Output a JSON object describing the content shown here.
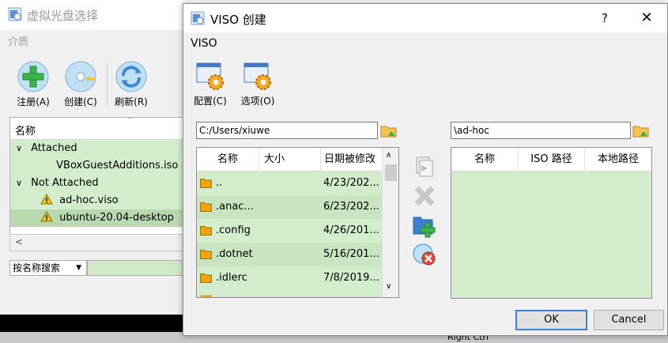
{
  "background_window": {
    "title": "虚拟光盘选择",
    "medium_label": "介质",
    "toolbar": [
      {
        "label": "注册(A)",
        "icon": "add-icon"
      },
      {
        "label": "创建(C)",
        "icon": "disc-create-icon"
      },
      {
        "label": "刷新(R)",
        "icon": "refresh-icon"
      }
    ],
    "list_header": "名称",
    "groups": [
      {
        "label": "Attached",
        "items": [
          "VBoxGuestAdditions.iso"
        ]
      },
      {
        "label": "Not Attached",
        "items": [
          "ad-hoc.viso",
          "ubuntu-20.04-desktop"
        ]
      }
    ],
    "search_mode": "按名称搜索",
    "taskbar_right_ctrl": "Right Ctrl"
  },
  "dialog": {
    "title": "VISO 创建",
    "help": "?",
    "close": "✕",
    "heading": "VISO",
    "toolbar": [
      {
        "label": "配置(C)",
        "icon": "config-gear-icon"
      },
      {
        "label": "选项(O)",
        "icon": "options-gear-icon"
      }
    ],
    "host_path": "C:/Users/xiuwe",
    "viso_path": "\\ad-hoc",
    "host_columns": [
      "名称",
      "大小",
      "日期被修改"
    ],
    "host_files": [
      {
        "name": "..",
        "size": "",
        "date": "4/23/202..."
      },
      {
        "name": ".anac...",
        "size": "",
        "date": "6/23/202..."
      },
      {
        "name": ".config",
        "size": "",
        "date": "4/26/201..."
      },
      {
        "name": ".dotnet",
        "size": "",
        "date": "5/16/201..."
      },
      {
        "name": ".idlerc",
        "size": "",
        "date": "7/8/2019..."
      }
    ],
    "viso_columns": [
      "名称",
      "ISO 路径",
      "本地路径"
    ],
    "ok_label": "OK",
    "cancel_label": "Cancel"
  },
  "colors": {
    "grid_green": "#d3edcc",
    "folder_orange": "#f0a30a",
    "accent_blue": "#3c7fd1"
  }
}
